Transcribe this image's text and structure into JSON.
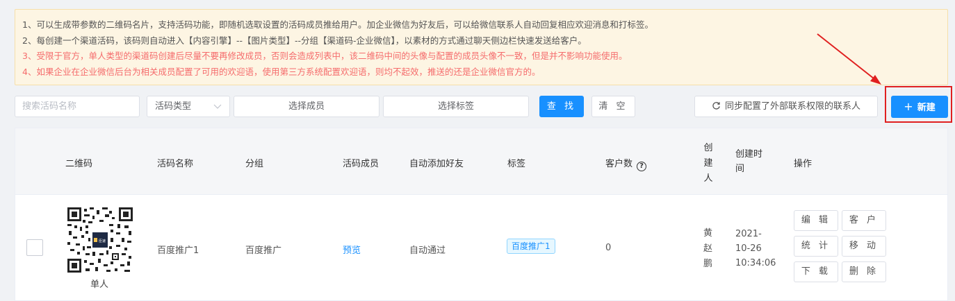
{
  "notice": {
    "lines": [
      "1、可以生成带参数的二维码名片，支持活码功能，即随机选取设置的活码成员推给用户。加企业微信为好友后，可以给微信联系人自动回复相应欢迎消息和打标签。",
      "2、每创建一个渠道活码，该码则自动进入【内容引擎】--【图片类型】--分组【渠道码-企业微信】，以素材的方式通过聊天侧边栏快速发送给客户。",
      "3、受限于官方，单人类型的渠道码创建后尽量不要再修改成员，否则会造成列表中，该二维码中间的头像与配置的成员头像不一致，但是并不影响功能使用。",
      "4、如果企业在企业微信后台为相关成员配置了可用的欢迎语，使用第三方系统配置欢迎语，则均不起效，推送的还是企业微信官方的。"
    ]
  },
  "toolbar": {
    "search_placeholder": "搜索活码名称",
    "type_select": "活码类型",
    "member_select": "选择成员",
    "tag_select": "选择标签",
    "search_button": "查 找",
    "clear_button": "清 空",
    "sync_button": "同步配置了外部联系权限的联系人",
    "new_button": "新建"
  },
  "table": {
    "headers": {
      "qrcode": "二维码",
      "name": "活码名称",
      "group": "分组",
      "members": "活码成员",
      "auto_add": "自动添加好友",
      "tags": "标签",
      "customers": "客户数",
      "creator": "创建人",
      "created_at_1": "创建时",
      "created_at_2": "间",
      "actions": "操作"
    },
    "rows": [
      {
        "qr_label": "单人",
        "qr_center": "臣速",
        "name": "百度推广1",
        "group": "百度推广",
        "members": "预览",
        "auto_add": "自动通过",
        "tag": "百度推广1",
        "customers": "0",
        "creator": "黄赵鹏",
        "date_1": "2021-",
        "date_2": "10-26",
        "time": "10:34:06",
        "actions": {
          "edit": "编 辑",
          "customer": "客 户",
          "stats": "统 计",
          "move": "移 动",
          "download": "下 载",
          "delete": "删 除"
        }
      }
    ]
  },
  "colors": {
    "primary": "#1890ff",
    "warning_bg": "#fdf5e3",
    "warning_text": "#f56c6c",
    "highlight": "#e02020"
  }
}
